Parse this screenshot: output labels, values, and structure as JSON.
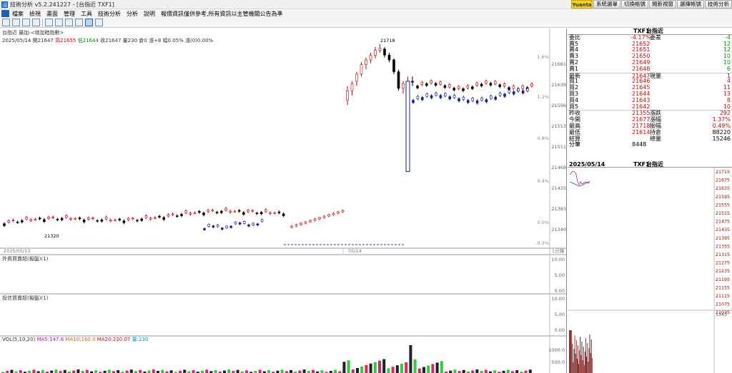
{
  "window": {
    "title": "技術分析 v5.2.241227 - [台指近 TXF1]"
  },
  "top_buttons": [
    "系統選單",
    "切換帳號",
    "閱新視窗",
    "選擇帳號",
    "技術分析"
  ],
  "brand": "Yuanta",
  "menu": [
    "檔案",
    "檢視",
    "畫面",
    "管理",
    "工具",
    "技術分析",
    "分析",
    "說明",
    "報價資訊僅供參考,所有資訊以主管機關公告為準"
  ],
  "chart": {
    "symbol_line": "台指近 最加:<增加暗指數>",
    "date": "2025/05/14",
    "stats": [
      "開21647",
      "高21655",
      "低21644",
      "收21647",
      "量230",
      "倉0",
      "漲+8",
      "幅0.05%",
      "漲(0)0.00%"
    ],
    "peak_label": "21718",
    "low_label": "21320",
    "date_left": "2025/05/13",
    "date_mid": "05/14",
    "period_label": "1分鐘",
    "ind1_label": "外資買賣超(擬盤)(1)",
    "ind2_label": "投信買賣超(擬盤)(1)",
    "vol_label": "VOL(5,10,20)",
    "vol_ma": [
      "MA5:147.8",
      "MA10:160.0",
      "MA20:220.07",
      "量:230"
    ],
    "price_axis": [
      "21681",
      "21639",
      "21596",
      "21553",
      "21511",
      "21468",
      "21425",
      "21383",
      "21340"
    ],
    "pct_axis": [
      "1.6%",
      "1.2%",
      "0.8%",
      "0.4%",
      "0.0%",
      "-0.2%"
    ],
    "ind_axis": [
      "10.00",
      "5.00",
      "0.00"
    ],
    "vol_axis": [
      "1000.0",
      "500.0"
    ]
  },
  "quote": {
    "header": {
      "symbol": "TXF1",
      "name": "台指近"
    },
    "ratio": {
      "label": "委比",
      "value": "-4.17%",
      "label2": "委差",
      "value2": "-4"
    },
    "asks": [
      {
        "label": "賣5",
        "price": "21652",
        "qty": "12"
      },
      {
        "label": "賣4",
        "price": "21651",
        "qty": "12"
      },
      {
        "label": "賣3",
        "price": "21650",
        "qty": "10"
      },
      {
        "label": "賣2",
        "price": "21649",
        "qty": "10"
      },
      {
        "label": "賣1",
        "price": "21648",
        "qty": "6"
      }
    ],
    "last": {
      "label": "最新",
      "price": "21647",
      "label2": "現量",
      "qty": "1"
    },
    "bids": [
      {
        "label": "買1",
        "price": "21646",
        "qty": "4"
      },
      {
        "label": "買2",
        "price": "21645",
        "qty": "11"
      },
      {
        "label": "買3",
        "price": "21644",
        "qty": "13"
      },
      {
        "label": "買4",
        "price": "21643",
        "qty": "8"
      },
      {
        "label": "買5",
        "price": "21642",
        "qty": "10"
      }
    ],
    "stats": [
      {
        "l1": "昨收",
        "v1": "21355",
        "l2": "漲跌",
        "v2": "292"
      },
      {
        "l1": "今開",
        "v1": "21677",
        "l2": "漲幅",
        "v2": "1.37%"
      },
      {
        "l1": "最高",
        "v1": "21718",
        "l2": "振幅",
        "v2": "0.49%"
      },
      {
        "l1": "最低",
        "v1": "21614",
        "l2": "持倉",
        "v2": "88220"
      },
      {
        "l1": "結算",
        "v1": "",
        "l2": "總量",
        "v2": "15246"
      },
      {
        "l1": "分筆",
        "v1": "8448",
        "l2": "",
        "v2": ""
      }
    ]
  },
  "mini": {
    "date": "2025/05/14",
    "symbol": "TXF1",
    "name": "台指近",
    "axis": [
      "21715",
      "21675",
      "21635",
      "21595",
      "21555",
      "21515",
      "21475",
      "21435",
      "21395",
      "21355",
      "21315",
      "21275",
      "21235",
      "21195",
      "21155",
      "21115",
      "21075",
      "21035"
    ],
    "vol_axis": "1343"
  }
}
